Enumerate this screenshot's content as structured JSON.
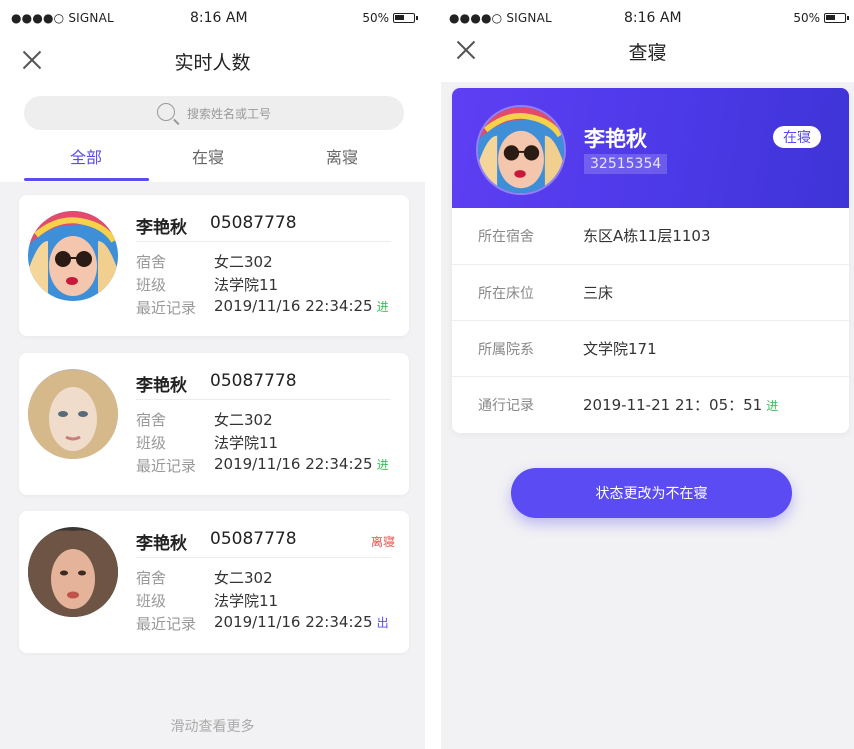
{
  "colors": {
    "accent": "#5a4bf2",
    "in": "#3bc15c",
    "leave": "#e8524d",
    "out": "#5a4bf2"
  },
  "status_bar": {
    "signal": "●●●●○ SIGNAL",
    "time": "8:16 AM",
    "battery": "50%"
  },
  "left_screen": {
    "title": "实时人数",
    "search": {
      "placeholder": "搜索姓名或工号"
    },
    "tabs": [
      "全部",
      "在寝",
      "离寝"
    ],
    "active_tab": "全部",
    "labels": {
      "dorm": "宿舍",
      "class": "班级",
      "record": "最近记录"
    },
    "cards": [
      {
        "name": "李艳秋",
        "id": "05087778",
        "status": "",
        "dorm": "女二302",
        "class": "法学院11",
        "record": "2019/11/16 22:34:25",
        "direction": "进"
      },
      {
        "name": "李艳秋",
        "id": "05087778",
        "status": "",
        "dorm": "女二302",
        "class": "法学院11",
        "record": "2019/11/16 22:34:25",
        "direction": "进"
      },
      {
        "name": "李艳秋",
        "id": "05087778",
        "status": "离寝",
        "dorm": "女二302",
        "class": "法学院11",
        "record": "2019/11/16 22:34:25",
        "direction": "出"
      }
    ],
    "more_text": "滑动查看更多"
  },
  "right_screen": {
    "title": "查寝",
    "profile": {
      "name": "李艳秋",
      "id": "32515354",
      "status": "在寝"
    },
    "info": [
      {
        "label": "所在宿舍",
        "value": "东区A栋11层1103"
      },
      {
        "label": "所在床位",
        "value": "三床"
      },
      {
        "label": "所属院系",
        "value": "文学院171"
      },
      {
        "label": "通行记录",
        "value": "2019-11-21 21：05：51",
        "direction": "进"
      }
    ],
    "button": "状态更改为不在寝"
  }
}
